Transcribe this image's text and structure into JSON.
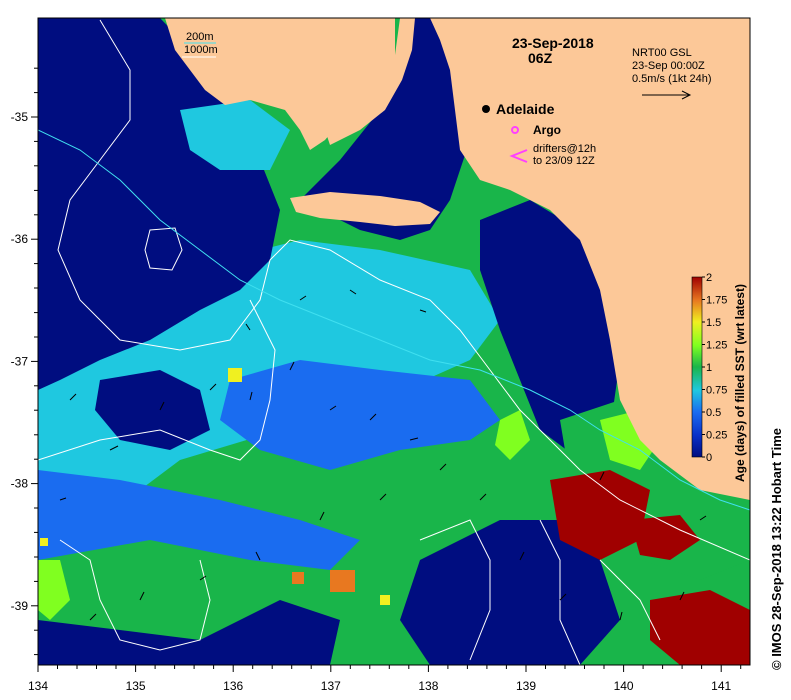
{
  "map": {
    "date": "23-Sep-2018",
    "time": "06Z",
    "place": "Adelaide",
    "lon_ticks": [
      "134",
      "135",
      "136",
      "137",
      "138",
      "139",
      "140",
      "141"
    ],
    "lat_ticks": [
      "-35",
      "-36",
      "-37",
      "-38",
      "-39"
    ],
    "depth_legend": {
      "line1": "200m",
      "line2": "1000m"
    },
    "current_legend": {
      "line1": "NRT00 GSL",
      "line2": "23-Sep 00:00Z",
      "line3": "0.5m/s (1kt 24h)"
    },
    "argo_label": "Argo",
    "drifters": {
      "line1": "drifters@12h",
      "line2": "to 23/09 12Z"
    },
    "colorbar": {
      "title": "Age (days) of filled SST (wrt latest)",
      "ticks": [
        "2",
        "1.75",
        "1.5",
        "1.25",
        "1",
        "0.75",
        "0.5",
        "0.25",
        "0"
      ],
      "range": [
        0,
        2
      ]
    },
    "credit": "© IMOS 28-Sep-2018 13:22 Hobart Time",
    "colors": {
      "land": "#fcc898",
      "deep_blue": "#000d80",
      "blue": "#1a6cf0",
      "cyan": "#1fc8e0",
      "green": "#19b54a",
      "lime": "#80ff20",
      "yellow": "#f0f020",
      "orange": "#e87820",
      "red": "#a00000",
      "isobath_200": "#40e0f0",
      "isobath_1000": "#ffffff",
      "argo": "#ff40ff"
    }
  }
}
